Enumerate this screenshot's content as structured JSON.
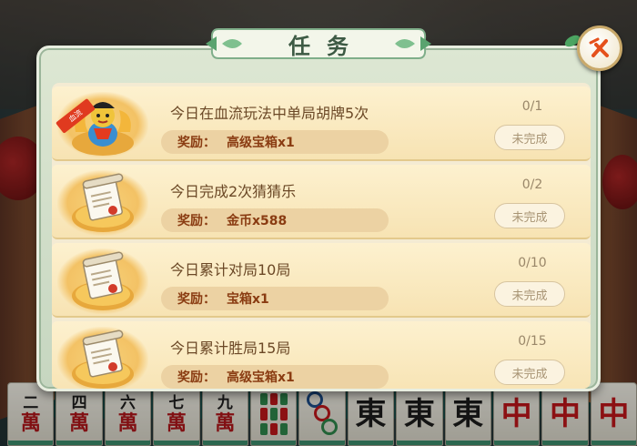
{
  "panel": {
    "title": "任务",
    "close_icon": "close-x-icon"
  },
  "tasks": [
    {
      "title": "今日在血流玩法中单局胡牌5次",
      "reward_label": "奖励：",
      "reward_value": "高级宝箱x1",
      "progress": "0/1",
      "status": "未完成",
      "icon": "treasure-character-icon",
      "tag": "血流",
      "has_tag": true
    },
    {
      "title": "今日完成2次猜猜乐",
      "reward_label": "奖励：",
      "reward_value": "金币x588",
      "progress": "0/2",
      "status": "未完成",
      "icon": "scroll-icon"
    },
    {
      "title": "今日累计对局10局",
      "reward_label": "奖励：",
      "reward_value": "宝箱x1",
      "progress": "0/10",
      "status": "未完成",
      "icon": "scroll-icon"
    },
    {
      "title": "今日累计胜局15局",
      "reward_label": "奖励：",
      "reward_value": "高级宝箱x1",
      "progress": "0/15",
      "status": "未完成",
      "icon": "scroll-icon"
    }
  ],
  "hand_tiles": [
    {
      "type": "wan",
      "num": "二",
      "suit": "萬"
    },
    {
      "type": "wan",
      "num": "四",
      "suit": "萬"
    },
    {
      "type": "wan",
      "num": "六",
      "suit": "萬"
    },
    {
      "type": "wan",
      "num": "七",
      "suit": "萬"
    },
    {
      "type": "wan",
      "num": "九",
      "suit": "萬"
    },
    {
      "type": "bamboo"
    },
    {
      "type": "circles"
    },
    {
      "type": "honor",
      "char": "東",
      "color": "black"
    },
    {
      "type": "honor",
      "char": "東",
      "color": "black"
    },
    {
      "type": "honor",
      "char": "東",
      "color": "black"
    },
    {
      "type": "honor",
      "char": "中",
      "color": "red"
    },
    {
      "type": "honor",
      "char": "中",
      "color": "red"
    },
    {
      "type": "honor",
      "char": "中",
      "color": "red"
    }
  ],
  "colors": {
    "panel_border": "#c6d6c0",
    "row_bg": "#fdf1cf",
    "reward_text": "#8a3c12",
    "title_text": "#3d5a44"
  }
}
